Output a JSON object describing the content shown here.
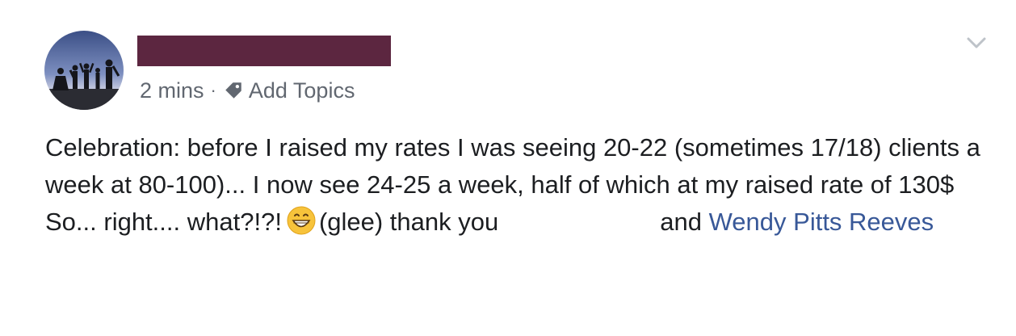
{
  "post": {
    "timestamp": "2 mins",
    "separator": "·",
    "add_topics": "Add Topics",
    "line1": "Celebration: before I raised my rates I was seeing 20-22 (sometimes 17/18) clients a week at 80-100)... I now see 24-25 a week, half of which at my raised rate of 130$",
    "line2_start": "So... right.... what?!?!",
    "line2_after_emoji": "(glee) thank you",
    "line2_and": "and",
    "mention": "Wendy Pitts Reeves"
  },
  "icons": {
    "tag": "tag-icon",
    "emoji": "grinning-face-icon",
    "menu": "chevron-down-icon"
  },
  "colors": {
    "link": "#385898",
    "meta": "#616770",
    "redaction": "#5c2640"
  }
}
